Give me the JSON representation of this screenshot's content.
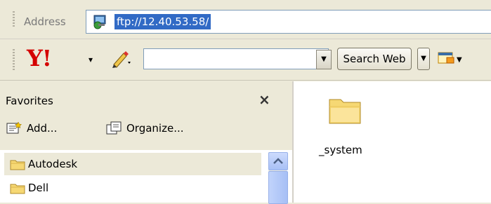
{
  "address_bar": {
    "label": "Address",
    "value": "ftp://12.40.53.58/",
    "icon": "network-globe-icon"
  },
  "yahoo_toolbar": {
    "logo_text": "Y!",
    "dropdown_arrow": "▾",
    "search_value": "",
    "search_button_label": "Search Web",
    "icon_pencil": "pencil-icon",
    "icon_mail": "mail-icon"
  },
  "favorites": {
    "title": "Favorites",
    "close_glyph": "×",
    "add_label": "Add...",
    "organize_label": "Organize...",
    "items": [
      {
        "label": "Autodesk",
        "selected": true
      },
      {
        "label": "Dell",
        "selected": false
      }
    ]
  },
  "content": {
    "items": [
      {
        "label": "_system",
        "icon": "folder-icon"
      }
    ]
  },
  "colors": {
    "chrome": "#ece9d8",
    "selection": "#316ac5",
    "folder": "#f6d874"
  }
}
